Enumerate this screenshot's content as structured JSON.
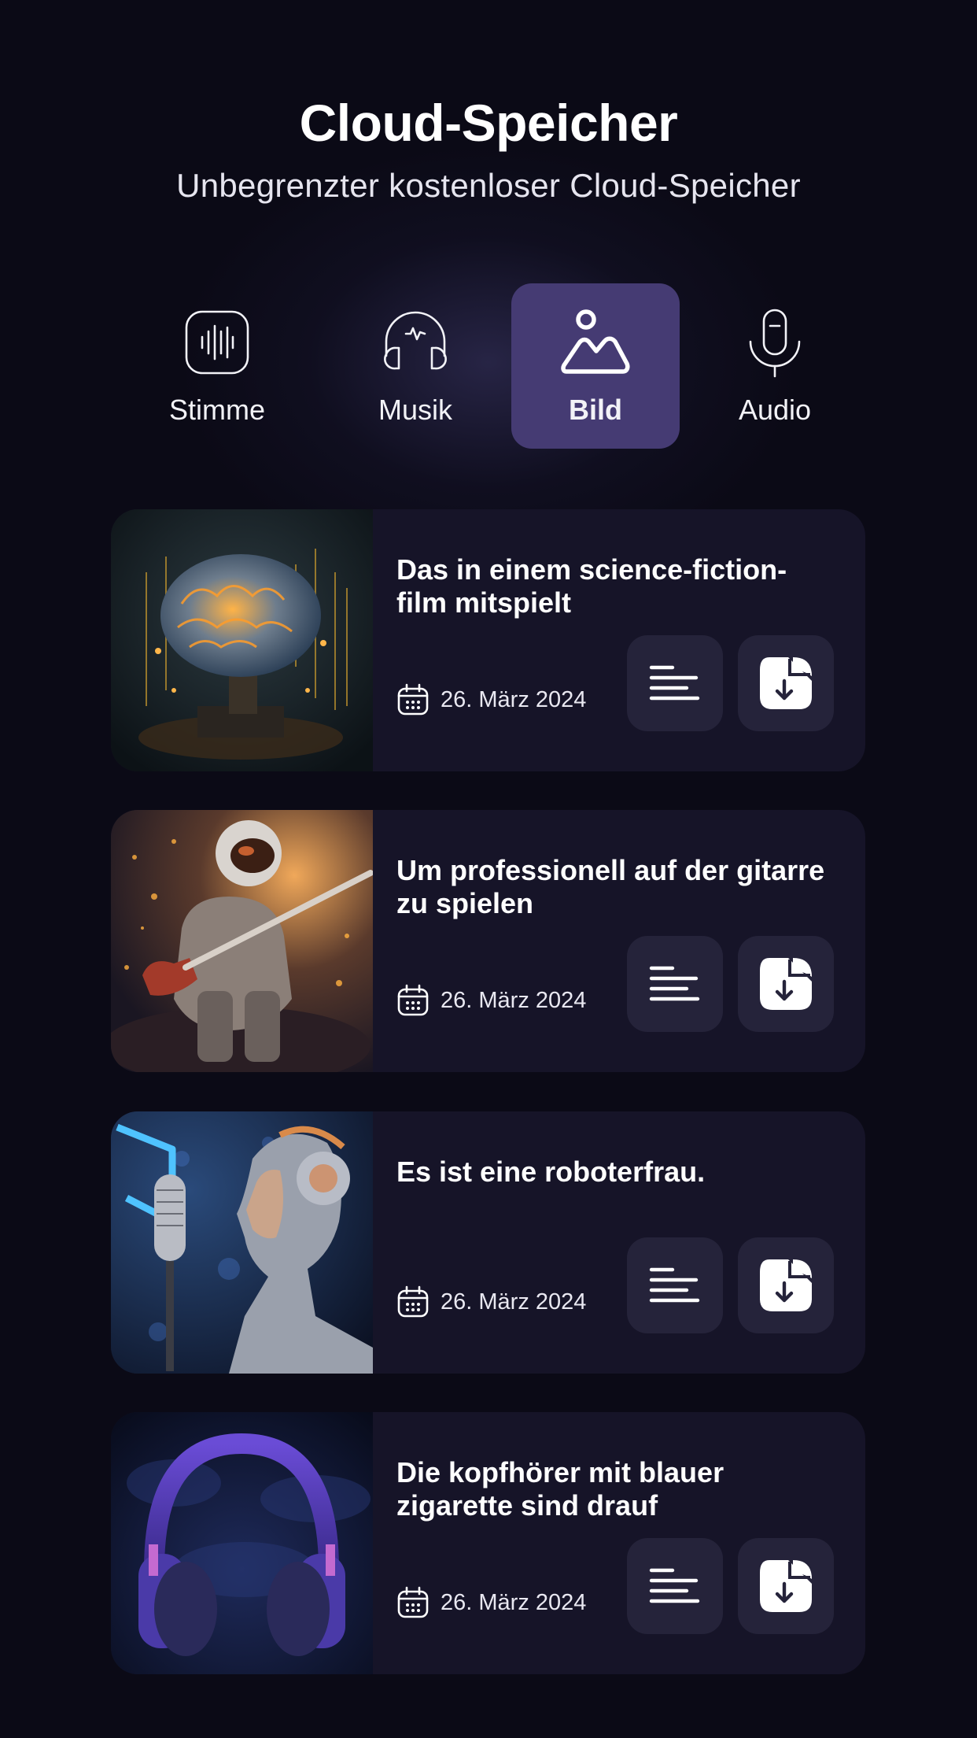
{
  "header": {
    "title": "Cloud-Speicher",
    "subtitle": "Unbegrenzter kostenloser Cloud-Speicher"
  },
  "tabs": [
    {
      "label": "Stimme",
      "icon": "voice-waveform-icon",
      "active": false
    },
    {
      "label": "Musik",
      "icon": "headphones-icon",
      "active": false
    },
    {
      "label": "Bild",
      "icon": "image-icon",
      "active": true
    },
    {
      "label": "Audio",
      "icon": "microphone-icon",
      "active": false
    }
  ],
  "items": [
    {
      "title": "Das in einem science-fiction-film mitspielt",
      "date": "26. März 2024",
      "image": "glowing brain on circuit board"
    },
    {
      "title": "Um professionell auf der gitarre zu spielen",
      "date": "26. März 2024",
      "image": "astronaut playing electric guitar"
    },
    {
      "title": "Es ist eine roboterfrau.",
      "date": "26. März 2024",
      "image": "robot woman with headphones and microphone"
    },
    {
      "title": "Die kopfhörer mit blauer zigarette sind drauf",
      "date": "26. März 2024",
      "image": "purple headphones"
    }
  ],
  "colors": {
    "background": "#0b0a16",
    "card": "#161428",
    "active_tab": "#453b73",
    "button": "#25233a"
  }
}
